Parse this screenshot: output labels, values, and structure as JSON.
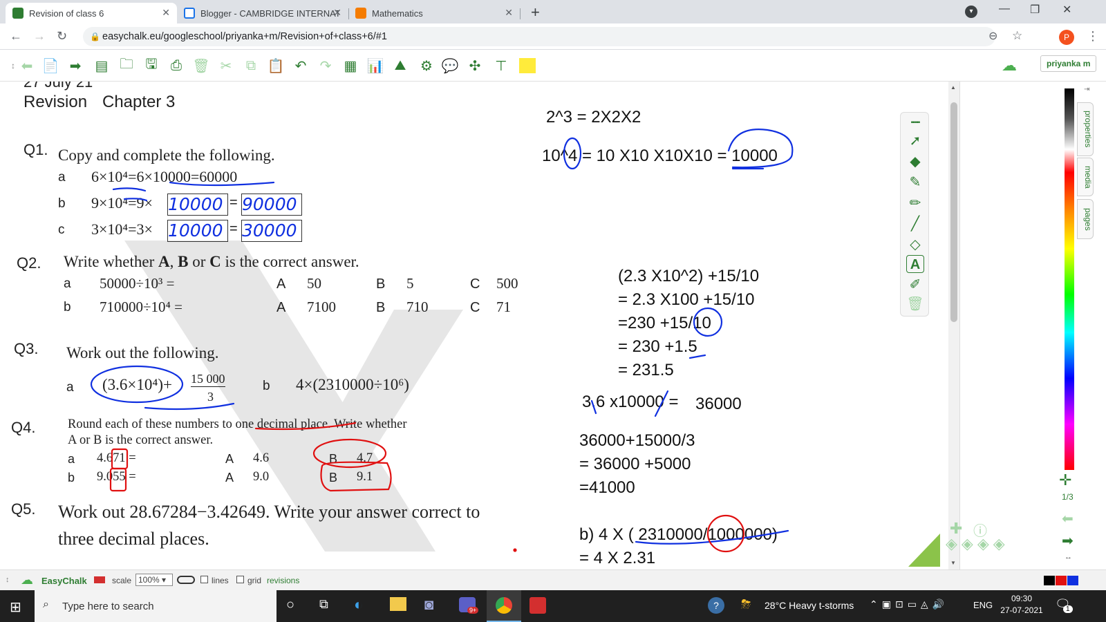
{
  "browser": {
    "tabs": [
      {
        "title": "Revision of class 6",
        "favicon": "easychalk-icon",
        "color": "#2e7d32"
      },
      {
        "title": "Blogger - CAMBRIDGE INTERNAT",
        "favicon": "blogger-icon",
        "color": "#1a73e8"
      },
      {
        "title": "Mathematics",
        "favicon": "blogger-orange-icon",
        "color": "#f57c00"
      }
    ],
    "url": "easychalk.eu/googleschool/priyanka+m/Revision+of+class+6/#1",
    "profile_initial": "P"
  },
  "app": {
    "user": "priyanka m",
    "brand": "EasyChalk",
    "scale_label": "scale",
    "scale_value": "100%",
    "lines_label": "lines",
    "grid_label": "grid",
    "revisions_label": "revisions",
    "page_indicator": "1/3",
    "side_tabs": [
      "properties",
      "media",
      "pages"
    ]
  },
  "board": {
    "partial_date": "27 July 21",
    "title_left": "Revision",
    "title_right": "Chapter 3",
    "q1": {
      "num": "Q1.",
      "text": "Copy and complete the following.",
      "rows": [
        {
          "label": "a",
          "expr": "6×10⁴=6×10000=60000"
        },
        {
          "label": "b",
          "expr": "9×10⁴=9×",
          "box1": "10000",
          "box2": "90000"
        },
        {
          "label": "c",
          "expr": "3×10⁴=3×",
          "box1": "10000",
          "box2": "30000"
        }
      ]
    },
    "q2": {
      "num": "Q2.",
      "text_pre": "Write whether ",
      "A": "A",
      "comma": ", ",
      "B": "B",
      "or": " or ",
      "C": "C",
      "text_post": " is the correct answer.",
      "rows": [
        {
          "label": "a",
          "expr": "50000÷10³ =",
          "a": "50",
          "b": "5",
          "c": "500"
        },
        {
          "label": "b",
          "expr": "710000÷10⁴ =",
          "a": "7100",
          "b": "710",
          "c": "71"
        }
      ]
    },
    "q3": {
      "num": "Q3.",
      "text": "Work out the following.",
      "a_label": "a",
      "a_expr": "(3.6×10⁴)+",
      "a_frac_num": "15 000",
      "a_frac_den": "3",
      "b_label": "b",
      "b_expr": "4×(2310000÷10⁶)"
    },
    "q4": {
      "num": "Q4.",
      "line1": "Round each of these numbers to one decimal place. Write whether",
      "line2": "A or B is the correct answer.",
      "rows": [
        {
          "label": "a",
          "value": "4.671 =",
          "A": "4.6",
          "B": "4.7"
        },
        {
          "label": "b",
          "value": "9.055 =",
          "A": "9.0",
          "B": "9.1"
        }
      ]
    },
    "q5": {
      "num": "Q5.",
      "line1": "Work out 28.67284−3.42649. Write your answer correct to",
      "line2": "three decimal places."
    },
    "notes": {
      "n1": "2^3 = 2X2X2",
      "n2": "10^4 = 10 X10 X10X10 = 10000",
      "n3": "(2.3 X10^2) +15/10",
      "n4": "= 2.3 X100 +15/10",
      "n5": "=230 +15/10",
      "n6": "= 230 +1.5",
      "n7": "= 231.5",
      "n8": "3.6 x10000 =",
      "n8b": "36000",
      "n9": "36000+15000/3",
      "n10": "= 36000 +5000",
      "n11": "=41000",
      "n12": "b) 4 X ( 2310000/1000000)",
      "n13": "= 4 X 2.31"
    }
  },
  "taskbar": {
    "search_placeholder": "Type here to search",
    "weather": "28°C  Heavy t-storms",
    "lang": "ENG",
    "time": "09:30",
    "date": "27-07-2021",
    "notification_count": "1"
  },
  "colors": {
    "accent": "#2e7d32",
    "ink_blue": "#1030e0",
    "ink_red": "#e01010"
  }
}
